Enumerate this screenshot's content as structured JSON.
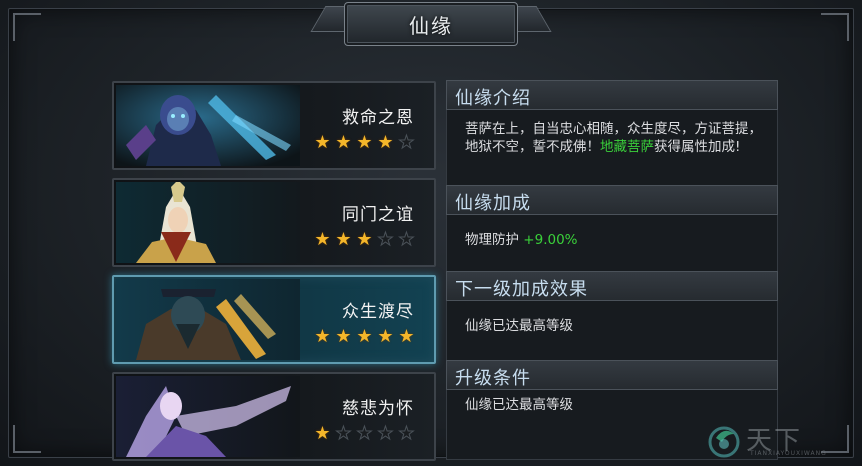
{
  "title": "仙缘",
  "cards": [
    {
      "name": "救命之恩",
      "stars": 4,
      "max_stars": 5,
      "selected": false
    },
    {
      "name": "同门之谊",
      "stars": 3,
      "max_stars": 5,
      "selected": false
    },
    {
      "name": "众生渡尽",
      "stars": 5,
      "max_stars": 5,
      "selected": true
    },
    {
      "name": "慈悲为怀",
      "stars": 1,
      "max_stars": 5,
      "selected": false
    }
  ],
  "intro": {
    "heading": "仙缘介绍",
    "text_before": "菩萨在上，自当忠心相随，众生度尽，方证菩提，地狱不空，誓不成佛！",
    "highlight": "地藏菩萨",
    "text_after": "获得属性加成!"
  },
  "bonus": {
    "heading": "仙缘加成",
    "stat_label": "物理防护",
    "stat_value": "+9.00%"
  },
  "next_level": {
    "heading": "下一级加成效果",
    "text": "仙缘已达最高等级"
  },
  "upgrade": {
    "heading": "升级条件",
    "text": "仙缘已达最高等级"
  },
  "watermark": {
    "text": "天下",
    "sub": "TIANXIAYOUXIWANG"
  },
  "colors": {
    "highlight_green": "#3ad13a",
    "star_on": "#f4b62a",
    "selected_border": "#5f9bb0"
  }
}
